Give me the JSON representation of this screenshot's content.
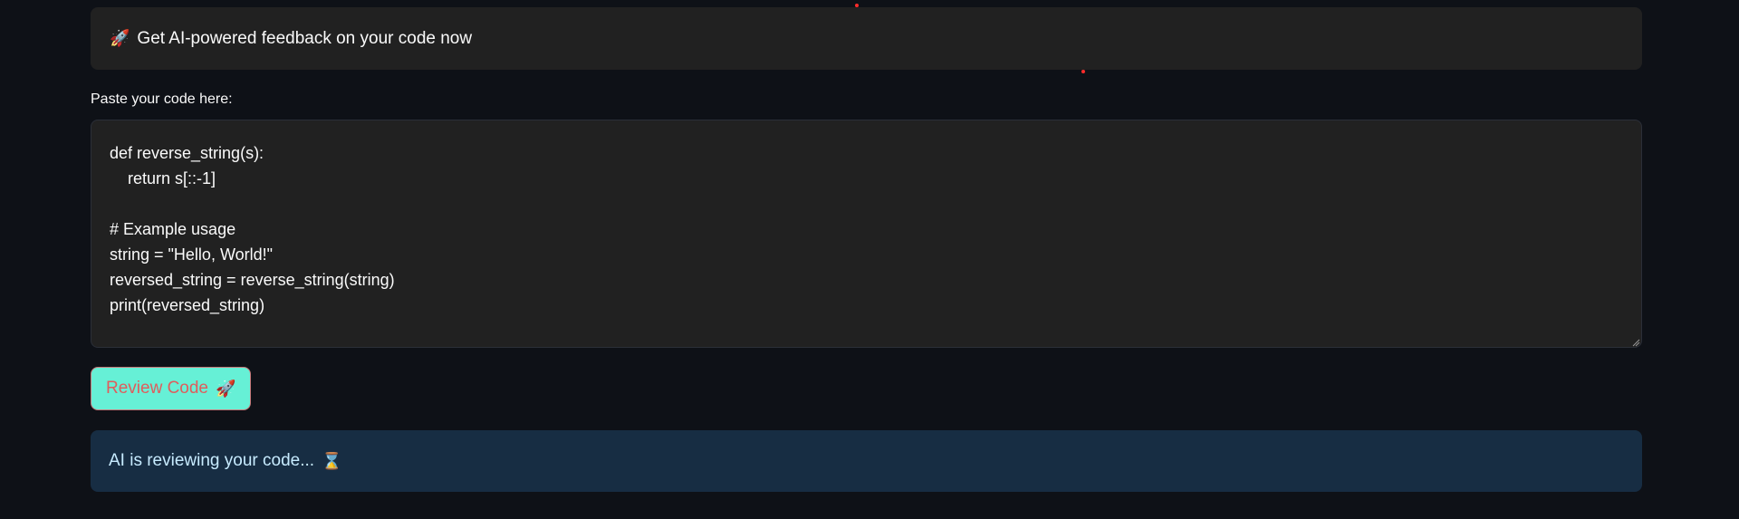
{
  "banner": {
    "icon": "rocket-icon",
    "text": "Get AI-powered feedback on your code now"
  },
  "code_input": {
    "label": "Paste your code here:",
    "value": "def reverse_string(s):\n    return s[::-1]\n\n# Example usage\nstring = \"Hello, World!\"\nreversed_string = reverse_string(string)\nprint(reversed_string)"
  },
  "review_button": {
    "label": "Review Code",
    "icon": "rocket-icon"
  },
  "status": {
    "text": "AI is reviewing your code...",
    "icon": "hourglass-icon"
  },
  "colors": {
    "background": "#0e1117",
    "button_bg": "#66f0d6",
    "button_text": "#e05c5c",
    "info_bg": "#172d43"
  }
}
